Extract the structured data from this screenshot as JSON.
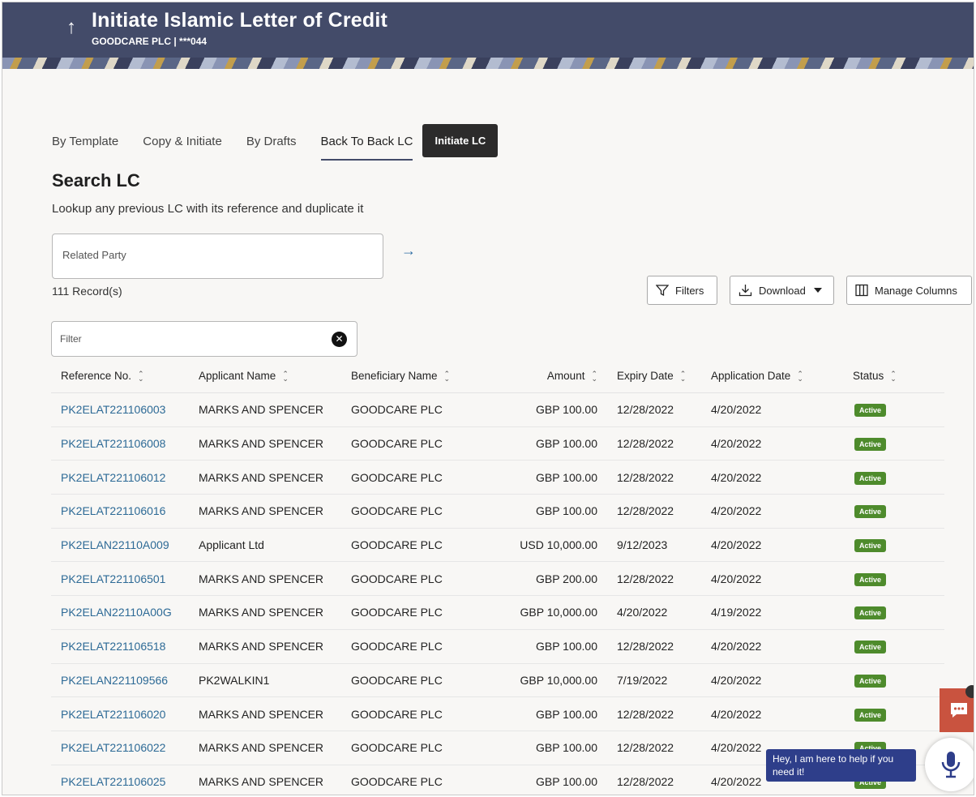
{
  "header": {
    "title": "Initiate Islamic Letter of Credit",
    "subtitle": "GOODCARE PLC | ***044",
    "back_icon": "↑"
  },
  "tabs": [
    {
      "label": "By Template"
    },
    {
      "label": "Copy & Initiate"
    },
    {
      "label": "By Drafts"
    },
    {
      "label": "Back To Back LC",
      "selected": true
    },
    {
      "label": "Initiate LC"
    }
  ],
  "search": {
    "title": "Search LC",
    "description": "Lookup any previous LC with its reference and duplicate it",
    "placeholder": "Related Party",
    "go_icon": "→"
  },
  "records_count": "111 Record(s)",
  "toolbar": {
    "filters_label": "Filters",
    "download_label": "Download",
    "manage_columns_label": "Manage Columns"
  },
  "filter": {
    "placeholder": "Filter",
    "clear_icon": "✕"
  },
  "table": {
    "columns": [
      "Reference No.",
      "Applicant Name",
      "Beneficiary Name",
      "Amount",
      "Expiry Date",
      "Application Date",
      "Status"
    ],
    "rows": [
      {
        "ref": "PK2ELAT221106003",
        "applicant": "MARKS AND SPENCER",
        "beneficiary": "GOODCARE PLC",
        "amount": "GBP 100.00",
        "expiry": "12/28/2022",
        "application": "4/20/2022",
        "status": "Active"
      },
      {
        "ref": "PK2ELAT221106008",
        "applicant": "MARKS AND SPENCER",
        "beneficiary": "GOODCARE PLC",
        "amount": "GBP 100.00",
        "expiry": "12/28/2022",
        "application": "4/20/2022",
        "status": "Active"
      },
      {
        "ref": "PK2ELAT221106012",
        "applicant": "MARKS AND SPENCER",
        "beneficiary": "GOODCARE PLC",
        "amount": "GBP 100.00",
        "expiry": "12/28/2022",
        "application": "4/20/2022",
        "status": "Active"
      },
      {
        "ref": "PK2ELAT221106016",
        "applicant": "MARKS AND SPENCER",
        "beneficiary": "GOODCARE PLC",
        "amount": "GBP 100.00",
        "expiry": "12/28/2022",
        "application": "4/20/2022",
        "status": "Active"
      },
      {
        "ref": "PK2ELAN22110A009",
        "applicant": "Applicant Ltd",
        "beneficiary": "GOODCARE PLC",
        "amount": "USD 10,000.00",
        "expiry": "9/12/2023",
        "application": "4/20/2022",
        "status": "Active"
      },
      {
        "ref": "PK2ELAT221106501",
        "applicant": "MARKS AND SPENCER",
        "beneficiary": "GOODCARE PLC",
        "amount": "GBP 200.00",
        "expiry": "12/28/2022",
        "application": "4/20/2022",
        "status": "Active"
      },
      {
        "ref": "PK2ELAN22110A00G",
        "applicant": "MARKS AND SPENCER",
        "beneficiary": "GOODCARE PLC",
        "amount": "GBP 10,000.00",
        "expiry": "4/20/2022",
        "application": "4/19/2022",
        "status": "Active"
      },
      {
        "ref": "PK2ELAT221106518",
        "applicant": "MARKS AND SPENCER",
        "beneficiary": "GOODCARE PLC",
        "amount": "GBP 100.00",
        "expiry": "12/28/2022",
        "application": "4/20/2022",
        "status": "Active"
      },
      {
        "ref": "PK2ELAN221109566",
        "applicant": "PK2WALKIN1",
        "beneficiary": "GOODCARE PLC",
        "amount": "GBP 10,000.00",
        "expiry": "7/19/2022",
        "application": "4/20/2022",
        "status": "Active"
      },
      {
        "ref": "PK2ELAT221106020",
        "applicant": "MARKS AND SPENCER",
        "beneficiary": "GOODCARE PLC",
        "amount": "GBP 100.00",
        "expiry": "12/28/2022",
        "application": "4/20/2022",
        "status": "Active"
      },
      {
        "ref": "PK2ELAT221106022",
        "applicant": "MARKS AND SPENCER",
        "beneficiary": "GOODCARE PLC",
        "amount": "GBP 100.00",
        "expiry": "12/28/2022",
        "application": "4/20/2022",
        "status": "Active"
      },
      {
        "ref": "PK2ELAT221106025",
        "applicant": "MARKS AND SPENCER",
        "beneficiary": "GOODCARE PLC",
        "amount": "GBP 100.00",
        "expiry": "12/28/2022",
        "application": "4/20/2022",
        "status": "Active"
      }
    ]
  },
  "assistant": {
    "message": "Hey, I am here to help if you need it!",
    "chat_icon": "chat-bubble-icon",
    "mic_icon": "microphone-icon"
  },
  "colors": {
    "header_bg": "#434b69",
    "link": "#2d6a96",
    "status_active": "#4e8b2c",
    "chat_tab": "#c9533f",
    "assistant_bubble": "#2e3e8a"
  }
}
